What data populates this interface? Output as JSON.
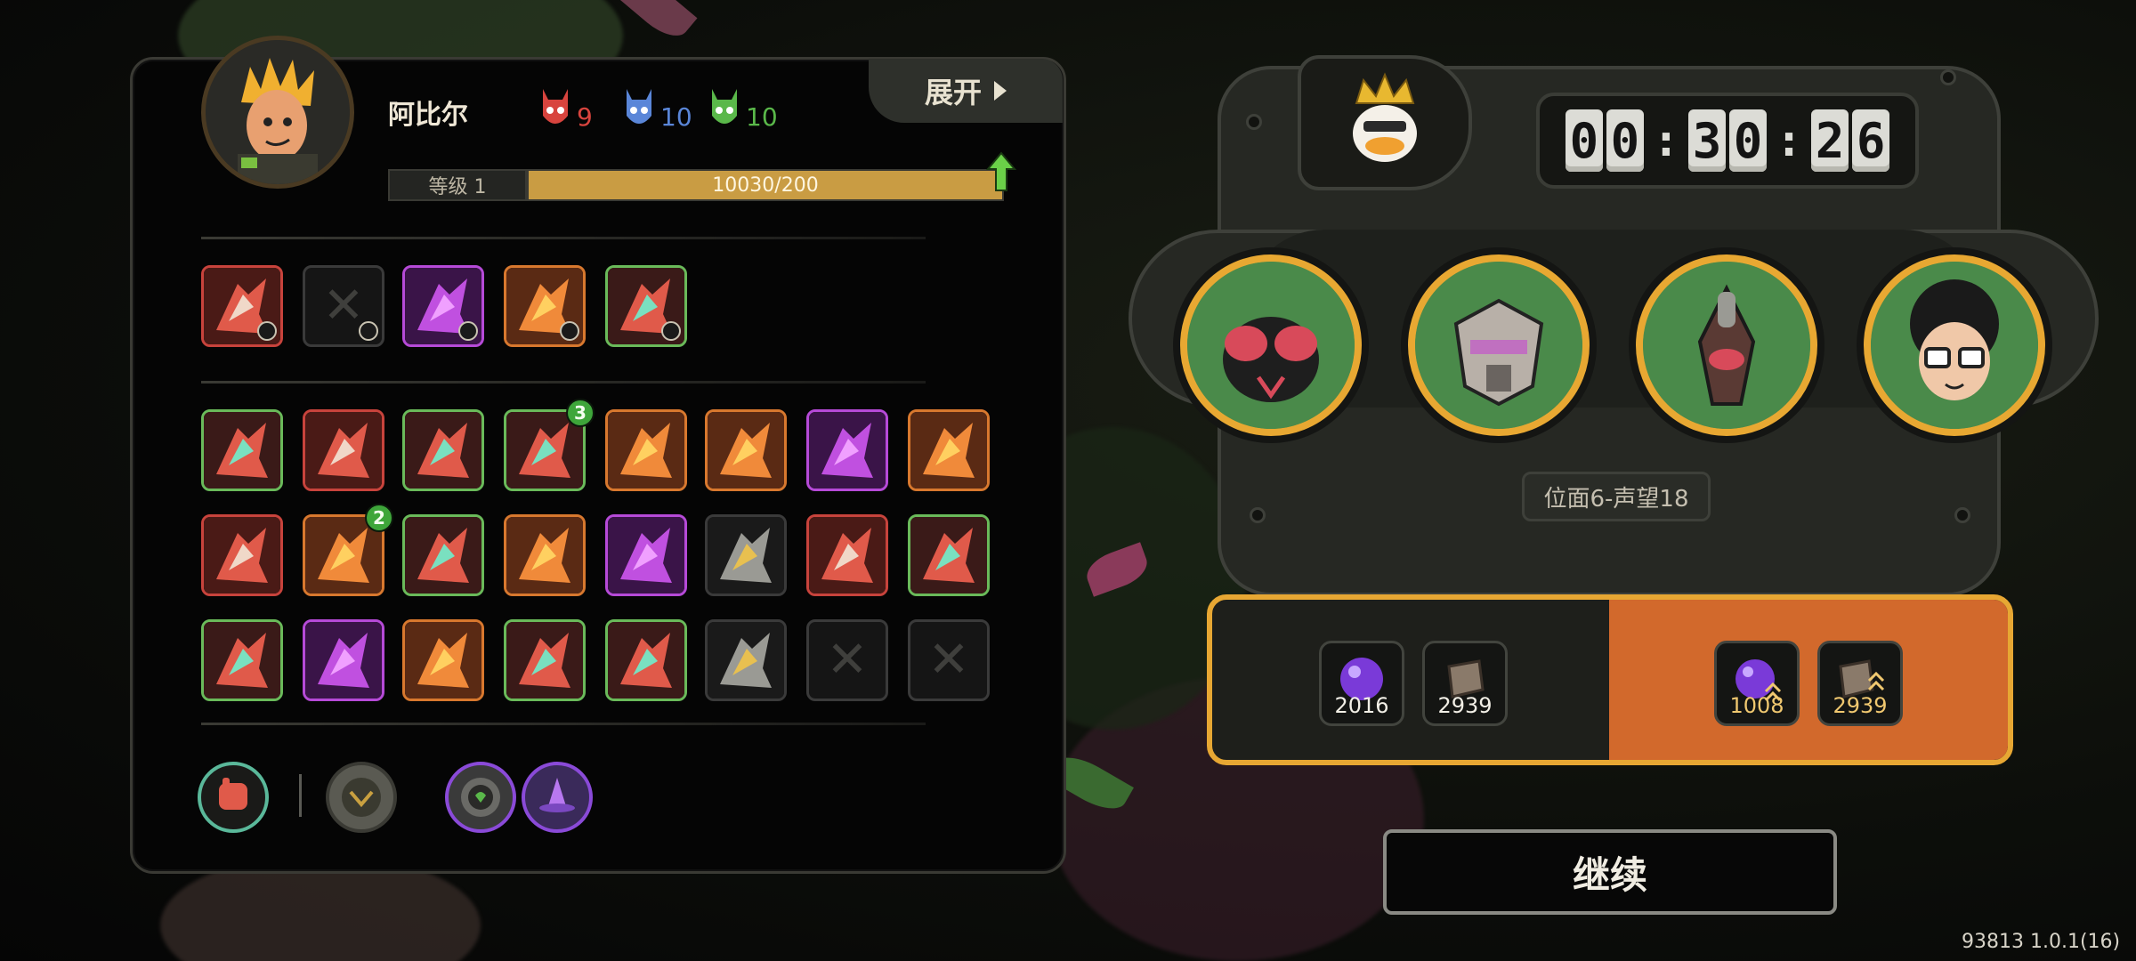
{
  "hero": {
    "name": "阿比尔",
    "stats": [
      {
        "icon": "red-mask-icon",
        "value": "9",
        "color": "#d8443e"
      },
      {
        "icon": "blue-mask-icon",
        "value": "10",
        "color": "#5a86d8"
      },
      {
        "icon": "green-mask-icon",
        "value": "10",
        "color": "#5ab84a"
      }
    ],
    "expand_label": "展开",
    "level_label": "等级 1",
    "xp_text": "10030/200",
    "xp_fill_fraction": 1.0
  },
  "active_skills": [
    {
      "icon": "claw-skill-icon",
      "border": "red"
    },
    {
      "icon": "empty-slot-icon",
      "border": "gray"
    },
    {
      "icon": "slash-skill-icon",
      "border": "purple"
    },
    {
      "icon": "fire-face-skill-icon",
      "border": "orange"
    },
    {
      "icon": "helmet-skill-icon",
      "border": "green"
    }
  ],
  "passive_skills": [
    {
      "icon": "blades-icon",
      "border": "green"
    },
    {
      "icon": "gears-icon",
      "border": "red"
    },
    {
      "icon": "dagger-icon",
      "border": "green"
    },
    {
      "icon": "banner-icon",
      "border": "green",
      "stack": "3"
    },
    {
      "icon": "teeth-icon",
      "border": "orange"
    },
    {
      "icon": "twin-blades-icon",
      "border": "orange"
    },
    {
      "icon": "star-orb-icon",
      "border": "purple"
    },
    {
      "icon": "gold-mask-icon",
      "border": "orange"
    },
    {
      "icon": "spears-icon",
      "border": "red"
    },
    {
      "icon": "twin-swords-icon",
      "border": "orange",
      "stack": "2"
    },
    {
      "icon": "twist-icon",
      "border": "green"
    },
    {
      "icon": "shield-orb-icon",
      "border": "orange"
    },
    {
      "icon": "lightning-icon",
      "border": "purple"
    },
    {
      "icon": "crown-burst-icon",
      "border": "gray"
    },
    {
      "icon": "vortex-icon",
      "border": "red"
    },
    {
      "icon": "hand-icon",
      "border": "green"
    },
    {
      "icon": "arrows-icon",
      "border": "green"
    },
    {
      "icon": "thorn-eye-icon",
      "border": "purple"
    },
    {
      "icon": "rocks-icon",
      "border": "orange"
    },
    {
      "icon": "green-flame-icon",
      "border": "green"
    },
    {
      "icon": "beast-green-icon",
      "border": "green"
    },
    {
      "icon": "beast-gray-icon",
      "border": "gray"
    },
    {
      "icon": "empty-slot-icon",
      "border": "gray"
    },
    {
      "icon": "empty-slot-icon",
      "border": "gray"
    }
  ],
  "equipment": [
    {
      "icon": "fist-icon"
    },
    {
      "icon": "beast-coin-icon"
    },
    {
      "icon": "heart-orb-icon"
    },
    {
      "icon": "witch-hat-icon"
    }
  ],
  "timer": {
    "hours": "00",
    "minutes": "30",
    "seconds": "26"
  },
  "opponents": [
    {
      "icon": "fly-creature-icon"
    },
    {
      "icon": "robot-mask-icon"
    },
    {
      "icon": "mantis-icon"
    },
    {
      "icon": "glasses-kid-icon"
    }
  ],
  "realm_label": "位面6-声望18",
  "rewards": {
    "base": [
      {
        "icon": "purple-orb-icon",
        "amount": "2016"
      },
      {
        "icon": "book-icon",
        "amount": "2939"
      }
    ],
    "boosted": [
      {
        "icon": "purple-orb-boost-icon",
        "amount": "1008"
      },
      {
        "icon": "book-boost-icon",
        "amount": "2939"
      }
    ]
  },
  "continue_label": "继续",
  "version": "93813 1.0.1(16)",
  "colors": {
    "accent_gold": "#e7a733",
    "reward_orange": "#d2692c",
    "xp_bar": "#c99c43"
  }
}
